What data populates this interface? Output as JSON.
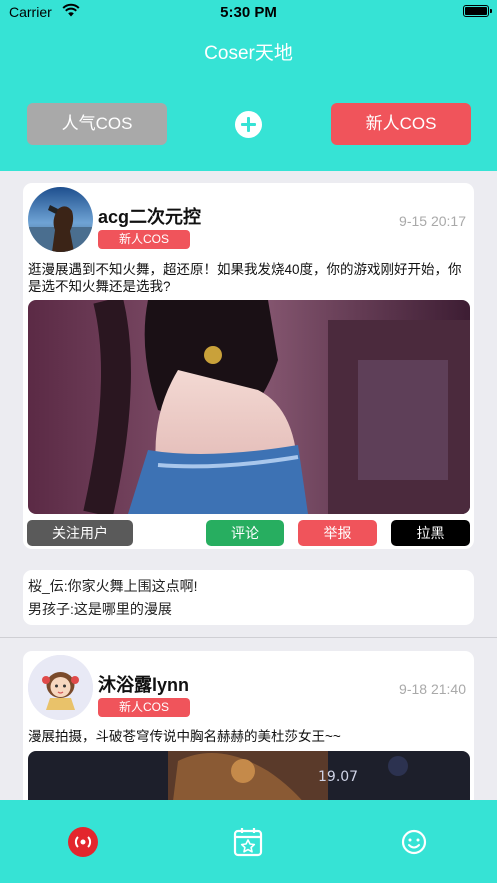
{
  "status_bar": {
    "carrier": "Carrier",
    "time": "5:30 PM"
  },
  "header": {
    "title": "Coser天地",
    "left_tab_label": "人气COS",
    "right_tab_label": "新人COS"
  },
  "posts": [
    {
      "username": "acg二次元控",
      "badge": "新人COS",
      "timestamp": "9-15 20:17",
      "text": "逛漫展遇到不知火舞，超还原！如果我发烧40度，你的游戏刚好开始，你是选不知火舞还是选我?",
      "actions": {
        "follow": "关注用户",
        "comment": "评论",
        "report": "举报",
        "block": "拉黑"
      },
      "comments": [
        "桜_伝:你家火舞上围这点啊!",
        "男孩子:这是哪里的漫展"
      ]
    },
    {
      "username": "沐浴露lynn",
      "badge": "新人COS",
      "timestamp": "9-18 21:40",
      "text": "漫展拍摄，斗破苍穹传说中胸名赫赫的美杜莎女王~~"
    }
  ],
  "tabbar": {
    "items": [
      "live-icon",
      "star-calendar-icon",
      "smile-icon"
    ]
  },
  "colors": {
    "accent": "#36e3d5",
    "red": "#f0545b",
    "green": "#27ae60",
    "gray": "#a9a9a9"
  }
}
